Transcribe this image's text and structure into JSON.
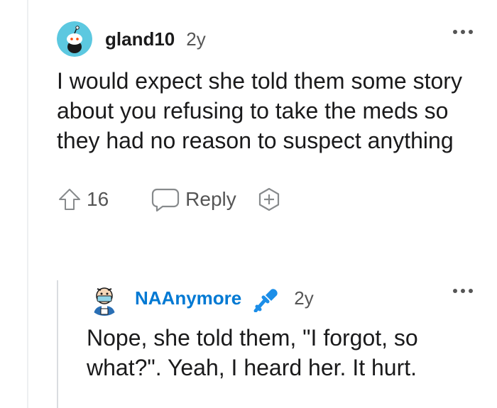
{
  "comment": {
    "username": "gland10",
    "timestamp": "2y",
    "body": "I would expect she told them some story about you refusing to take the meds so they had no reason to suspect anything",
    "vote_count": "16",
    "reply_label": "Reply",
    "avatar_icon": "snoo-avatar-icon",
    "avatar_color": "#5cc8e0"
  },
  "reply": {
    "username": "NAAnymore",
    "timestamp": "2y",
    "body": "Nope, she told them, \"I forgot, so what?\". Yeah, I heard her. It hurt.",
    "username_color": "#0079d3",
    "badge_icon": "microphone-icon",
    "badge_color": "#1c8ee8"
  }
}
